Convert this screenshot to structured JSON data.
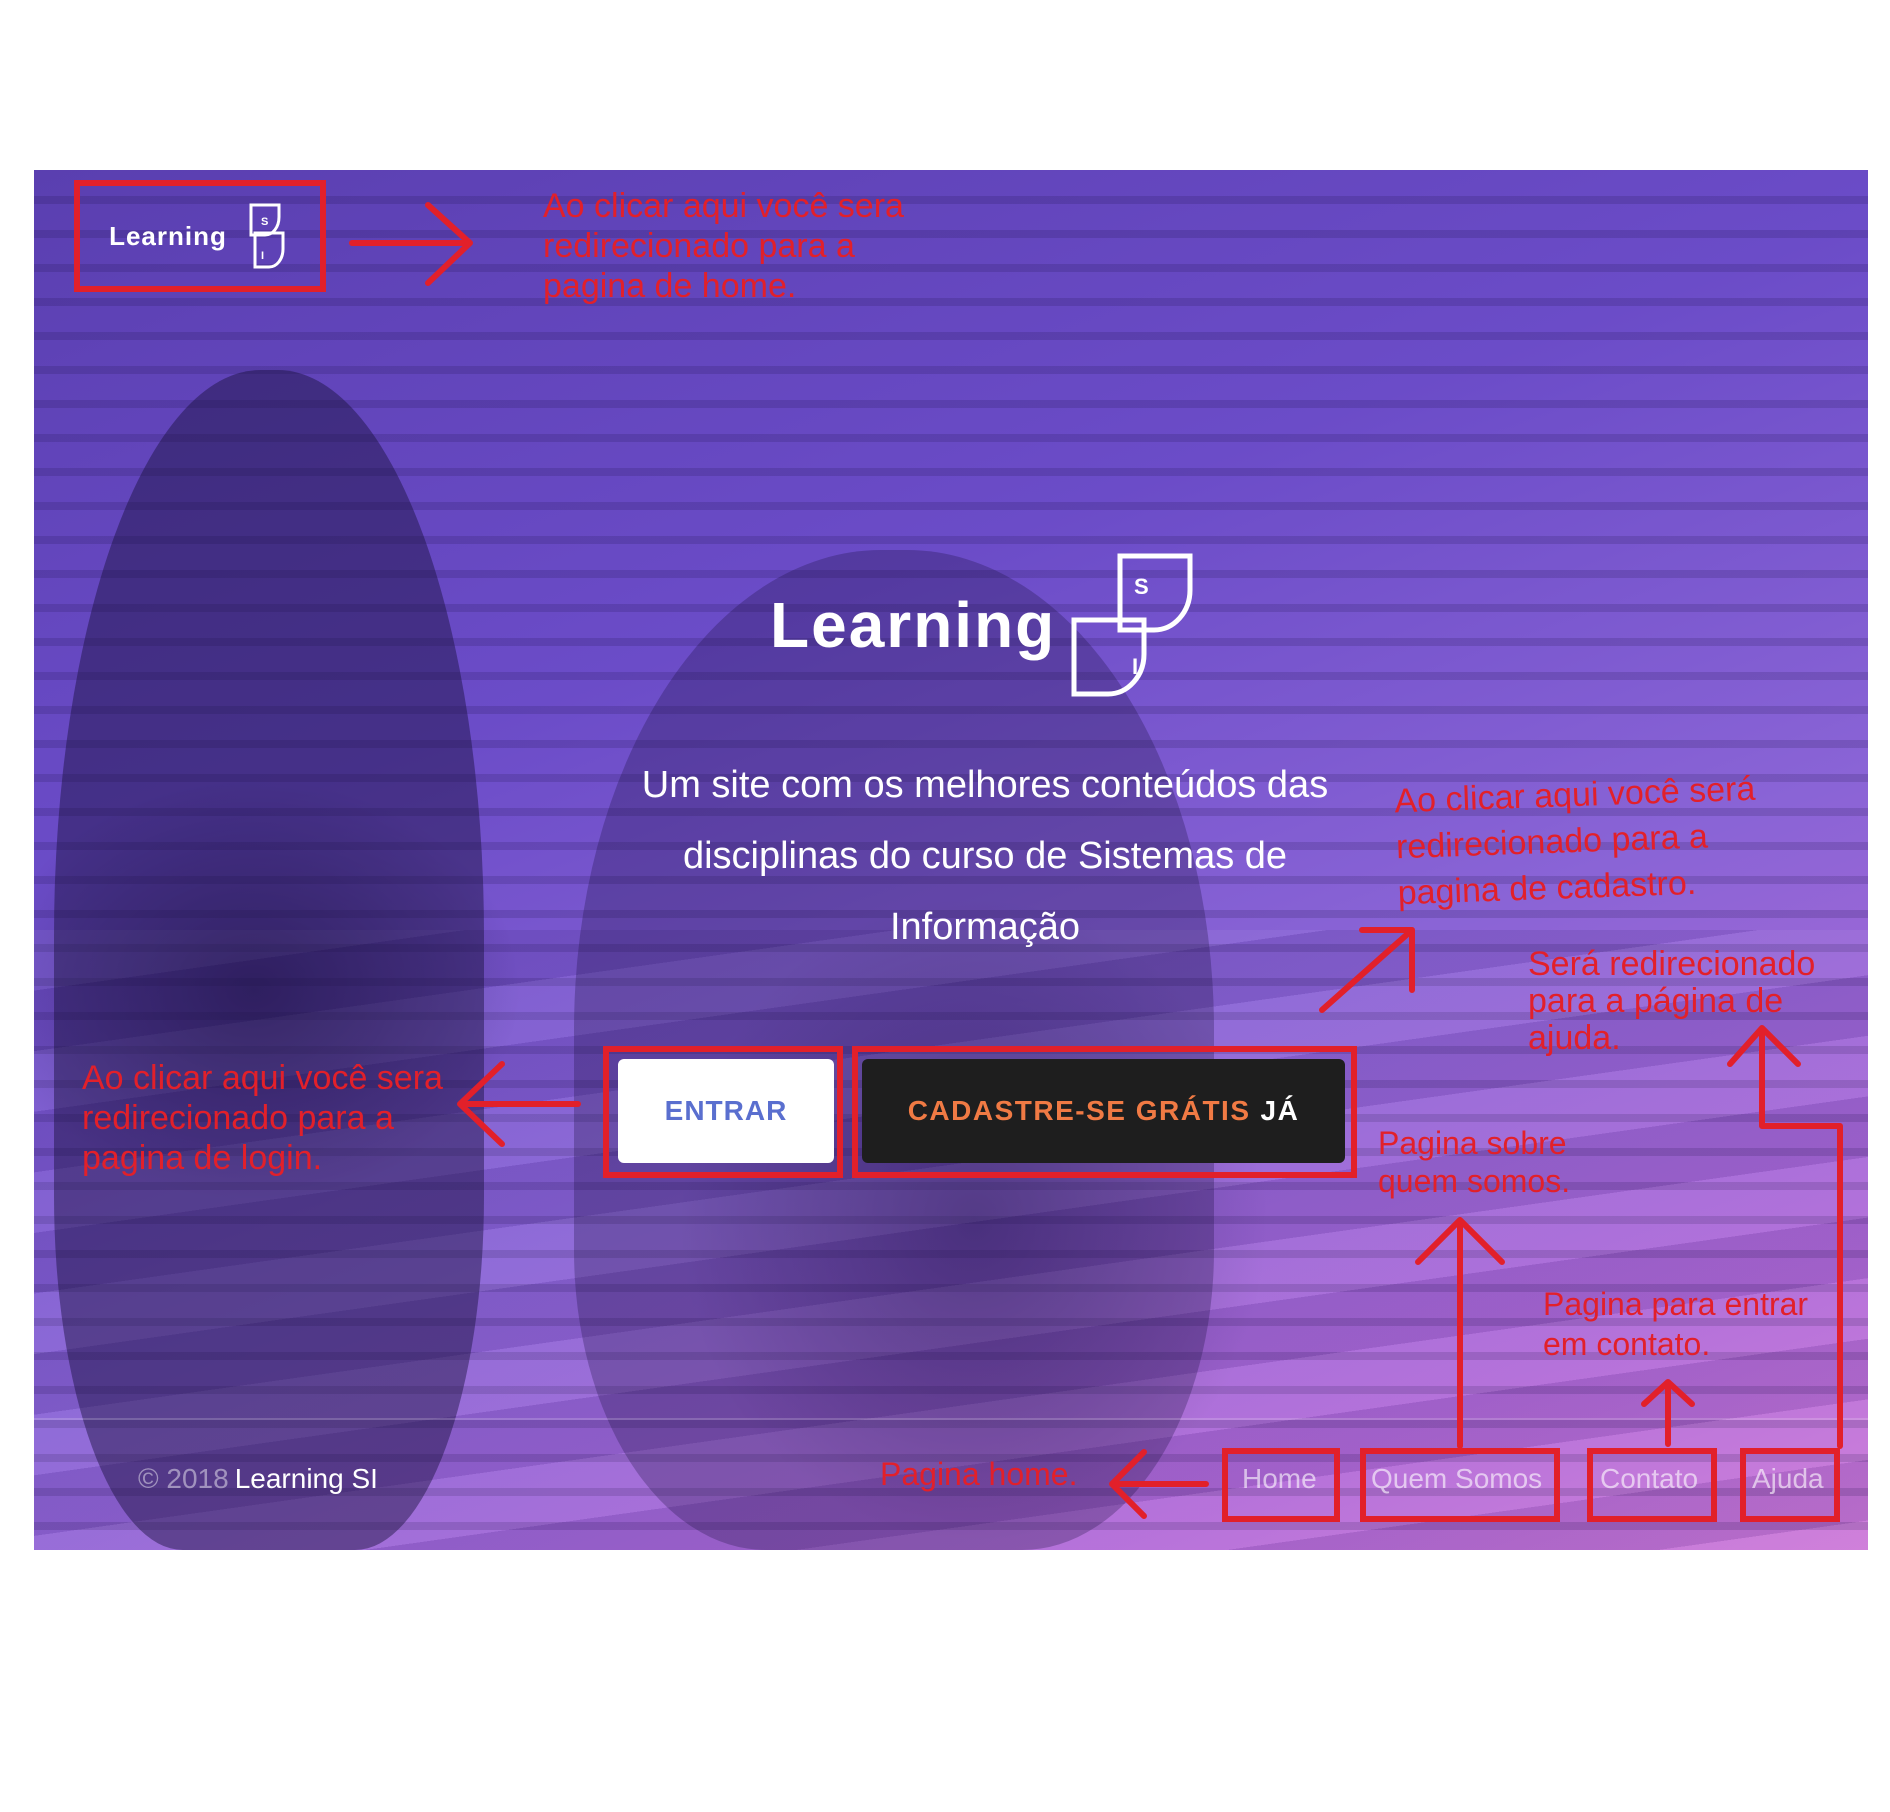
{
  "header": {
    "logo_text": "Learning",
    "logo_letters": [
      "S",
      "I"
    ]
  },
  "hero": {
    "logo_text": "Learning",
    "logo_letters": [
      "S",
      "I"
    ],
    "tagline_lines": [
      "Um site com os melhores conteúdos das",
      "disciplinas do curso de Sistemas de",
      "Informação"
    ],
    "enter_button": "ENTRAR",
    "signup_button_main": "CADASTRE-SE GRÁTIS",
    "signup_button_suffix": "JÁ"
  },
  "footer": {
    "copyright": "© 2018",
    "brand": "Learning SI",
    "nav": [
      "Home",
      "Quem Somos",
      "Contato",
      "Ajuda"
    ]
  },
  "annotations": {
    "logo_note": [
      "Ao clicar aqui você sera",
      "redirecionado para a",
      "pagina de home."
    ],
    "signup_note": [
      "Ao clicar aqui você será",
      "redirecionado para a",
      "pagina de cadastro."
    ],
    "help_note": [
      "Será redirecionado",
      "para a página de",
      "ajuda."
    ],
    "login_note": [
      "Ao clicar aqui você sera",
      "redirecionado para a",
      "pagina de login."
    ],
    "about_note": [
      "Pagina sobre",
      "quem somos."
    ],
    "contact_note": [
      "Pagina para entrar",
      "em contato."
    ],
    "home_note": "Pagina home.",
    "color": "#e2202a"
  },
  "colors": {
    "gradient_start": "#5a3fb0",
    "gradient_end": "#cd79d8",
    "enter_text": "#5a6fcf",
    "signup_bg": "#1e1e1e",
    "signup_accent": "#f07a44"
  }
}
